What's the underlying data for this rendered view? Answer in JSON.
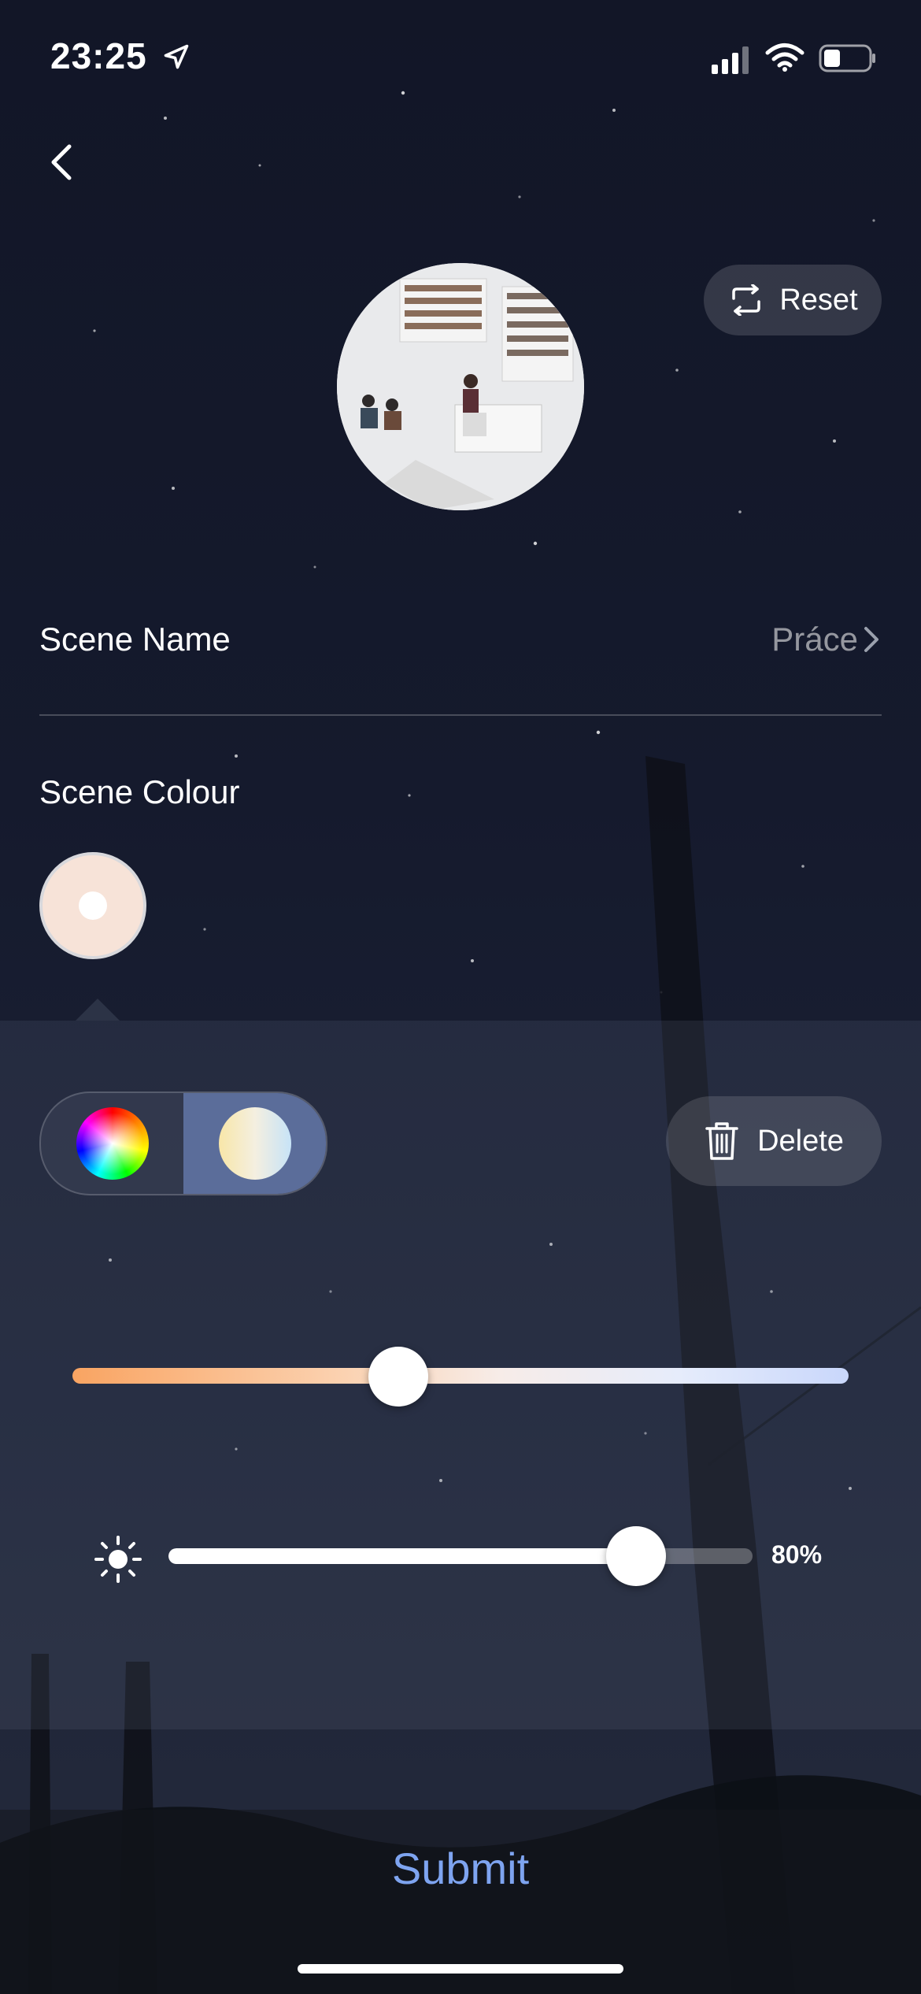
{
  "status_bar": {
    "time": "23:25",
    "icons": [
      "location-arrow-icon",
      "cellular-signal-icon",
      "wifi-icon",
      "battery-icon"
    ]
  },
  "header": {
    "back_icon": "chevron-left-icon",
    "reset_label": "Reset",
    "reset_icon": "repeat-icon"
  },
  "scene": {
    "name_label": "Scene Name",
    "name_value": "Práce",
    "colour_label": "Scene Colour",
    "colour_swatch": "#f7e3d8"
  },
  "colour_panel": {
    "modes": [
      "color-wheel",
      "white-temperature"
    ],
    "active_mode": "white-temperature",
    "delete_label": "Delete",
    "delete_icon": "trash-icon",
    "temperature_position": 0.42,
    "brightness_percent": 80,
    "brightness_label": "80%"
  },
  "footer": {
    "submit_label": "Submit"
  },
  "colors": {
    "accent": "#7ea4f0",
    "active_segment": "#5b6d9a"
  }
}
